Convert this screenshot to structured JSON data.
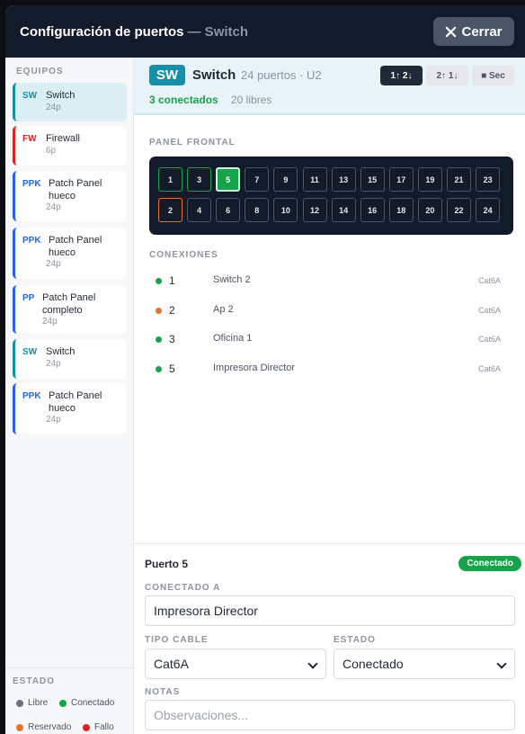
{
  "header": {
    "title": "Configuración de puertos",
    "subtitle": "— Switch",
    "close_label": "Cerrar"
  },
  "sidebar": {
    "section_label": "EQUIPOS",
    "items": [
      {
        "code": "SW",
        "name": "Switch",
        "count": "24p",
        "color": "#1690a8"
      },
      {
        "code": "FW",
        "name": "Firewall",
        "count": "6p",
        "color": "#dc2626"
      },
      {
        "code": "PPK",
        "name": "Patch Panel hueco",
        "count": "24p",
        "color": "#2563eb"
      },
      {
        "code": "PPK",
        "name": "Patch Panel hueco",
        "count": "24p",
        "color": "#2563eb"
      },
      {
        "code": "PP",
        "name": "Patch Panel completo",
        "count": "24p",
        "color": "#2563eb"
      },
      {
        "code": "SW",
        "name": "Switch",
        "count": "24p",
        "color": "#1690a8"
      },
      {
        "code": "PPK",
        "name": "Patch Panel hueco",
        "count": "24p",
        "color": "#2563eb"
      }
    ],
    "legend_label": "ESTADO",
    "legend": [
      {
        "label": "Libre",
        "color": "#6b7280"
      },
      {
        "label": "Conectado",
        "color": "#16a34a"
      },
      {
        "label": "Reservado",
        "color": "#e8742c"
      },
      {
        "label": "Fallo",
        "color": "#dc2626"
      }
    ]
  },
  "device": {
    "badge": "SW",
    "name": "Switch",
    "meta": "24 puertos · U2",
    "connected": "3 conectados",
    "free": "20 libres",
    "views": [
      "1↑ 2↓",
      "2↑ 1↓",
      "■ Sec"
    ]
  },
  "panel": {
    "label": "PANEL FRONTAL",
    "ports": [
      {
        "n": "1",
        "state": "conn"
      },
      {
        "n": "3",
        "state": "conn"
      },
      {
        "n": "5",
        "state": "active"
      },
      {
        "n": "7",
        "state": "free"
      },
      {
        "n": "9",
        "state": "free"
      },
      {
        "n": "11",
        "state": "free"
      },
      {
        "n": "13",
        "state": "free"
      },
      {
        "n": "15",
        "state": "free"
      },
      {
        "n": "17",
        "state": "free"
      },
      {
        "n": "19",
        "state": "free"
      },
      {
        "n": "21",
        "state": "free"
      },
      {
        "n": "23",
        "state": "free"
      },
      {
        "n": "2",
        "state": "res"
      },
      {
        "n": "4",
        "state": "free"
      },
      {
        "n": "6",
        "state": "free"
      },
      {
        "n": "8",
        "state": "free"
      },
      {
        "n": "10",
        "state": "free"
      },
      {
        "n": "12",
        "state": "free"
      },
      {
        "n": "14",
        "state": "free"
      },
      {
        "n": "16",
        "state": "free"
      },
      {
        "n": "18",
        "state": "free"
      },
      {
        "n": "20",
        "state": "free"
      },
      {
        "n": "22",
        "state": "free"
      },
      {
        "n": "24",
        "state": "free"
      }
    ]
  },
  "connections": {
    "label": "CONEXIONES",
    "rows": [
      {
        "port": "1",
        "name": "Switch 2",
        "cable": "Cat6A",
        "color": "#16a34a"
      },
      {
        "port": "2",
        "name": "Ap 2",
        "cable": "Cat6A",
        "color": "#e8742c"
      },
      {
        "port": "3",
        "name": "Oficina 1",
        "cable": "Cat6A",
        "color": "#16a34a"
      },
      {
        "port": "5",
        "name": "Impresora Director",
        "cable": "Cat6A",
        "color": "#16a34a"
      }
    ]
  },
  "detail": {
    "title": "Puerto 5",
    "status_pill": "Conectado",
    "connected_to_label": "CONECTADO A",
    "connected_to_value": "Impresora Director",
    "cable_label": "TIPO CABLE",
    "cable_value": "Cat6A",
    "state_label": "ESTADO",
    "state_value": "Conectado",
    "notes_label": "NOTAS",
    "notes_placeholder": "Observaciones..."
  }
}
